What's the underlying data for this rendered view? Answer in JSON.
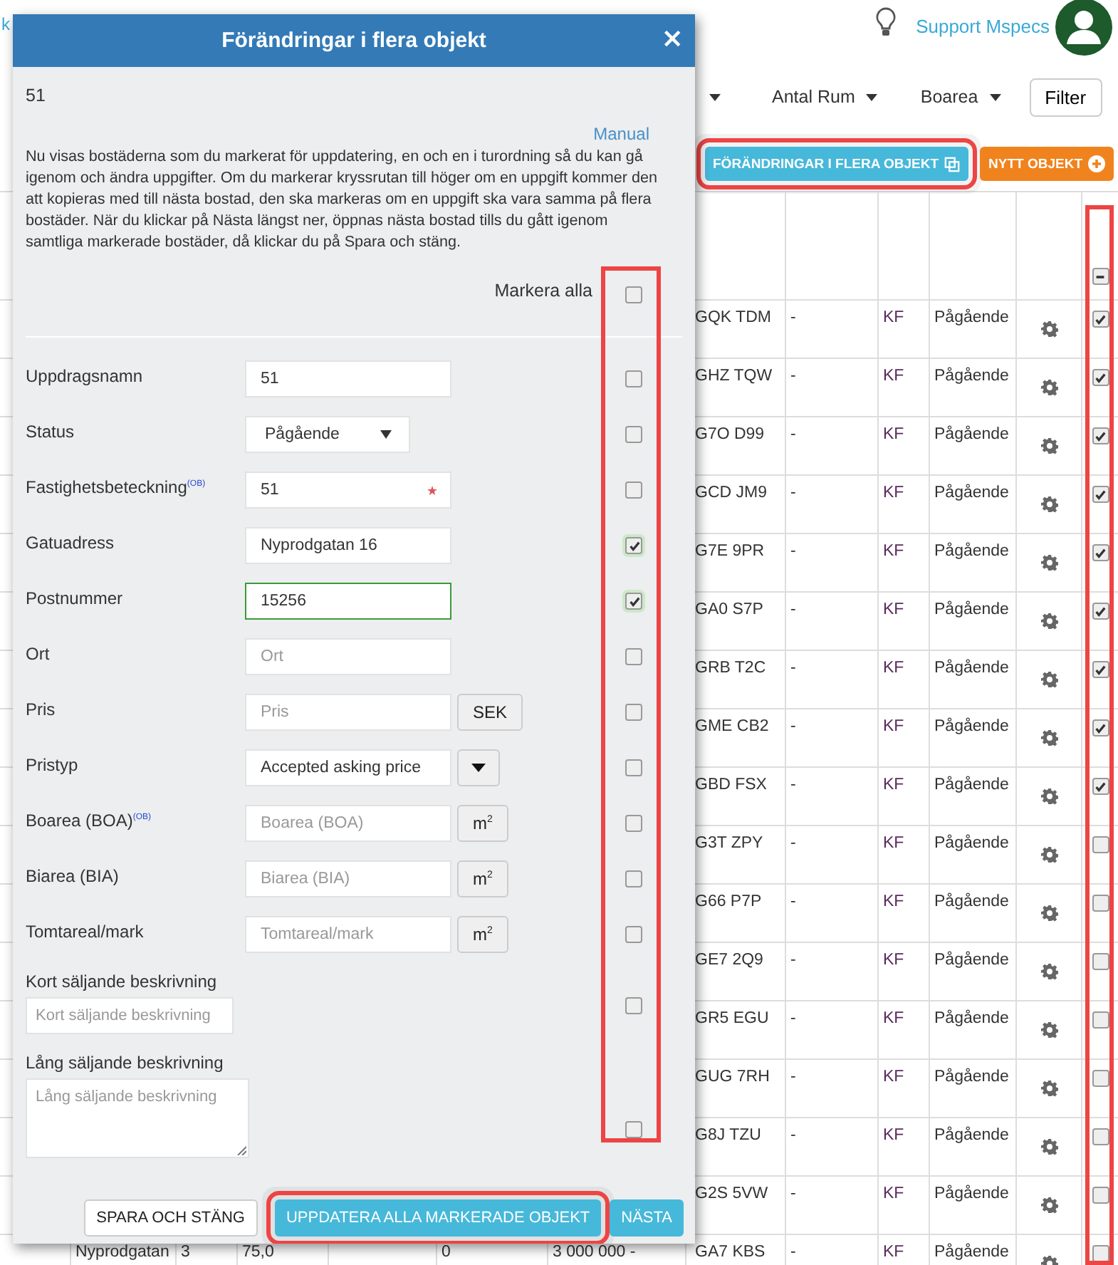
{
  "top_link": "k",
  "header": {
    "support_link": "Support Mspecs"
  },
  "filters": [
    {
      "kind": "caret"
    },
    {
      "kind": "dropdown",
      "label": "Antal Rum"
    },
    {
      "kind": "dropdown",
      "label": "Boarea"
    }
  ],
  "filter_button": "Filter",
  "actions": [
    {
      "label": "FÖRÄNDRINGAR I FLERA OBJEKT",
      "kind": "multi",
      "highlighted": true
    },
    {
      "label": "NYTT OBJEKT",
      "kind": "new",
      "highlighted": false
    }
  ],
  "table": {
    "header_checkbox_mixed": true,
    "rows": [
      {
        "code": "GQK TDM",
        "dash": "-",
        "type": "KF",
        "status": "Pågående",
        "checked": true
      },
      {
        "code": "GHZ TQW",
        "dash": "-",
        "type": "KF",
        "status": "Pågående",
        "checked": true
      },
      {
        "code": "G7O D99",
        "dash": "-",
        "type": "KF",
        "status": "Pågående",
        "checked": true
      },
      {
        "code": "GCD JM9",
        "dash": "-",
        "type": "KF",
        "status": "Pågående",
        "checked": true
      },
      {
        "code": "G7E 9PR",
        "dash": "-",
        "type": "KF",
        "status": "Pågående",
        "checked": true
      },
      {
        "code": "GA0 S7P",
        "dash": "-",
        "type": "KF",
        "status": "Pågående",
        "checked": true
      },
      {
        "code": "GRB T2C",
        "dash": "-",
        "type": "KF",
        "status": "Pågående",
        "checked": true
      },
      {
        "code": "GME CB2",
        "dash": "-",
        "type": "KF",
        "status": "Pågående",
        "checked": true
      },
      {
        "code": "GBD FSX",
        "dash": "-",
        "type": "KF",
        "status": "Pågående",
        "checked": true
      },
      {
        "code": "G3T ZPY",
        "dash": "-",
        "type": "KF",
        "status": "Pågående",
        "checked": false
      },
      {
        "code": "G66 P7P",
        "dash": "-",
        "type": "KF",
        "status": "Pågående",
        "checked": false
      },
      {
        "code": "GE7 2Q9",
        "dash": "-",
        "type": "KF",
        "status": "Pågående",
        "checked": false
      },
      {
        "code": "GR5 EGU",
        "dash": "-",
        "type": "KF",
        "status": "Pågående",
        "checked": false
      },
      {
        "code": "GUG 7RH",
        "dash": "-",
        "type": "KF",
        "status": "Pågående",
        "checked": false
      },
      {
        "code": "G8J TZU",
        "dash": "-",
        "type": "KF",
        "status": "Pågående",
        "checked": false
      },
      {
        "code": "G2S 5VW",
        "dash": "-",
        "type": "KF",
        "status": "Pågående",
        "checked": false
      },
      {
        "code": "GA7 KBS",
        "dash": "-",
        "type": "KF",
        "status": "Pågående",
        "checked": false,
        "address": "Nyprodgatan",
        "rooms": "3",
        "area": "75,0",
        "column_6": "0",
        "price": "3 000 000 -"
      }
    ]
  },
  "modal": {
    "title": "Förändringar i flera objekt",
    "close": "×",
    "subtitle": "51",
    "manual_link": "Manual",
    "intro": "Nu visas bostäderna som du markerat för uppdatering, en och en i turordning så du kan gå igenom och ändra uppgifter. Om du markerar kryssrutan till höger om en uppgift kommer den att kopieras med till nästa bostad, den ska markeras om en uppgift ska vara samma på flera bostäder. När du klickar på Nästa längst ner, öppnas nästa bostad tills du gått igenom samtliga markerade bostäder, då klickar du på Spara och stäng.",
    "select_all": {
      "label": "Markera alla",
      "checked": false
    },
    "fields": [
      {
        "kind": "text",
        "label": "Uppdragsnamn",
        "value": "51",
        "checked": false
      },
      {
        "kind": "select",
        "label": "Status",
        "value": "Pågående",
        "checked": false
      },
      {
        "kind": "text",
        "label": "Fastighetsbeteckning$^{(OB)}$",
        "value": "51",
        "required": true,
        "checked": false
      },
      {
        "kind": "text",
        "label": "Gatuadress",
        "value": "Nyprodgatan 16",
        "checked": true
      },
      {
        "kind": "text",
        "label": "Postnummer",
        "value": "15256",
        "focused": true,
        "checked": true
      },
      {
        "kind": "text",
        "label": "Ort",
        "placeholder": "Ort",
        "checked": false
      },
      {
        "kind": "addon",
        "label": "Pris",
        "placeholder": "Pris",
        "addon": "SEK",
        "checked": false
      },
      {
        "kind": "dropdown",
        "label": "Pristyp",
        "value": "Accepted asking price",
        "checked": false
      },
      {
        "kind": "addon",
        "label": "Boarea (BOA)$^{(OB)}$",
        "placeholder": "Boarea (BOA)",
        "addon": "m$^{2}$",
        "checked": false
      },
      {
        "kind": "addon",
        "label": "Biarea (BIA)",
        "placeholder": "Biarea (BIA)",
        "addon": "m$^{2}$",
        "checked": false
      },
      {
        "kind": "addon",
        "label": "Tomtareal/mark",
        "placeholder": "Tomtareal/mark",
        "addon": "m$^{2}$",
        "checked": false
      },
      {
        "kind": "short",
        "label": "Kort säljande beskrivning",
        "placeholder": "Kort säljande beskrivning",
        "checked": false
      },
      {
        "kind": "long",
        "label": "Lång säljande beskrivning",
        "placeholder": "Lång säljande beskrivning",
        "checked": false
      }
    ],
    "buttons": [
      {
        "label": "SPARA OCH STÄNG",
        "kind": "plain",
        "highlighted": false
      },
      {
        "label": "UPPDATERA ALLA MARKERADE OBJEKT",
        "kind": "primary",
        "highlighted": true
      },
      {
        "label": "NÄSTA",
        "kind": "primary",
        "highlighted": false
      }
    ]
  }
}
